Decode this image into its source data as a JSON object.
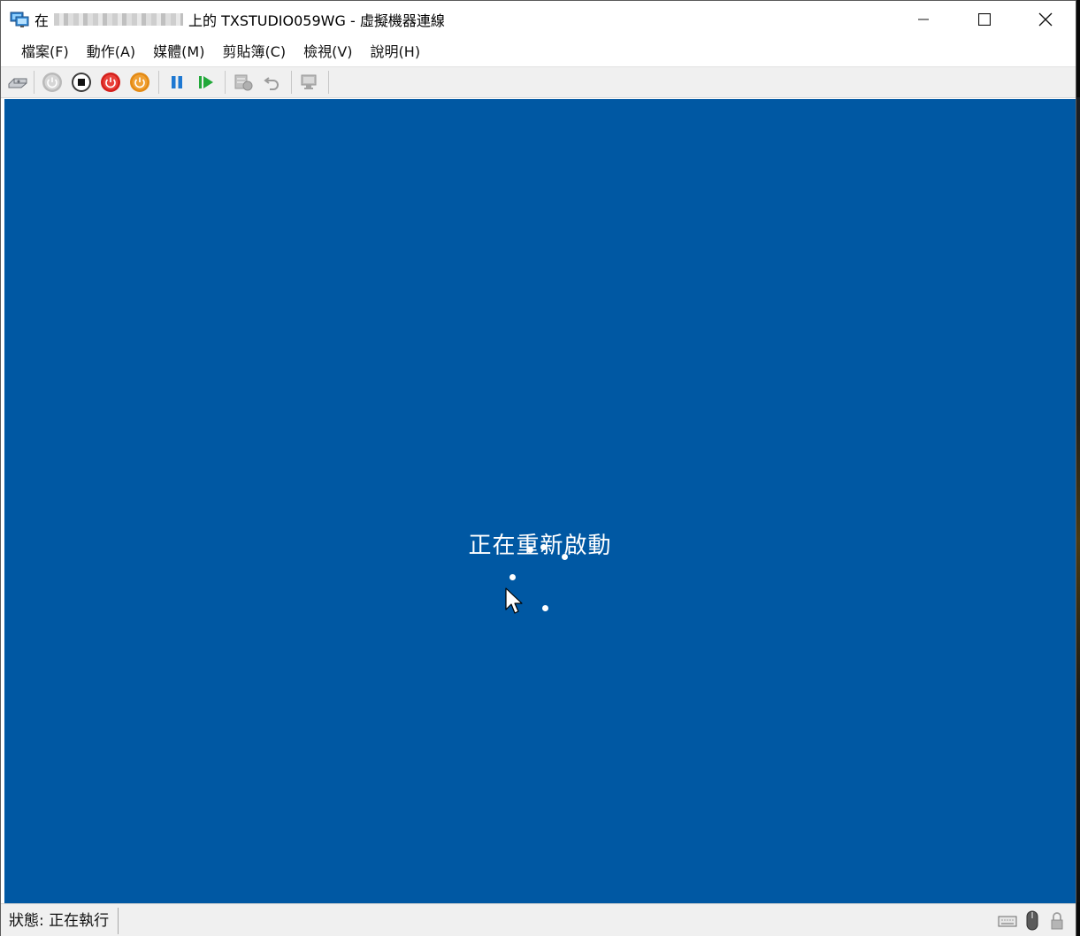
{
  "window": {
    "title_prefix": "在",
    "title_suffix": "上的 TXSTUDIO059WG - 虛擬機器連線",
    "minimize_glyph": "—",
    "maximize_glyph": "☐",
    "close_glyph": "✕"
  },
  "menu": {
    "items": [
      "檔案(F)",
      "動作(A)",
      "媒體(M)",
      "剪貼簿(C)",
      "檢視(V)",
      "說明(H)"
    ]
  },
  "toolbar": {
    "buttons": [
      {
        "name": "ctrl-alt-del-icon"
      },
      {
        "name": "start-icon"
      },
      {
        "name": "turn-off-icon"
      },
      {
        "name": "shutdown-icon"
      },
      {
        "name": "save-icon"
      },
      {
        "name": "pause-icon"
      },
      {
        "name": "resume-icon"
      },
      {
        "name": "checkpoint-icon"
      },
      {
        "name": "revert-icon"
      },
      {
        "name": "enhanced-session-icon"
      }
    ]
  },
  "vm": {
    "background_color": "#0058a3",
    "status_message": "正在重新啟動"
  },
  "statusbar": {
    "status_text": "狀態: 正在執行"
  },
  "colors": {
    "accent_red": "#d4201c",
    "accent_orange": "#e38a14",
    "accent_blue": "#1e78d2",
    "accent_green": "#22a83a"
  }
}
